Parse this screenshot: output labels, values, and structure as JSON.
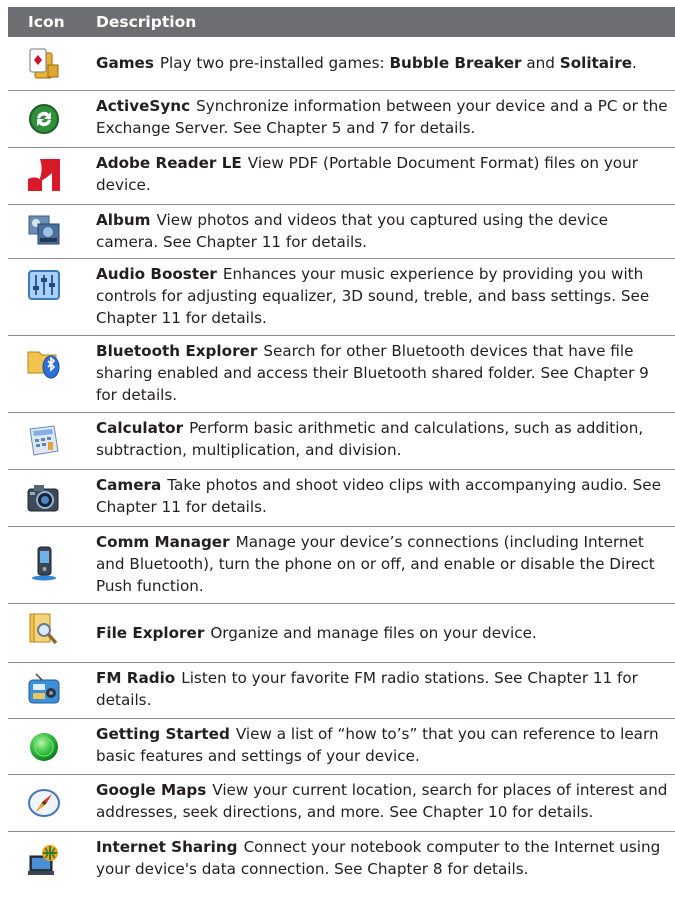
{
  "header": {
    "icon_label": "Icon",
    "description_label": "Description"
  },
  "rows": [
    {
      "icon": "games-icon",
      "name": "Games",
      "parts": [
        "Play two pre-installed games: ",
        "Bubble Breaker",
        " and ",
        "Solitaire",
        "."
      ]
    },
    {
      "icon": "activesync-icon",
      "name": "ActiveSync",
      "text": "Synchronize information between your device and a PC or the Exchange Server. See Chapter 5 and 7 for details."
    },
    {
      "icon": "adobe-reader-icon",
      "name": "Adobe Reader LE",
      "text": "View PDF (Portable Document Format) files on your device."
    },
    {
      "icon": "album-icon",
      "name": "Album",
      "text": "View photos and videos that you captured using the device camera. See Chapter 11 for details."
    },
    {
      "icon": "audio-booster-icon",
      "name": "Audio Booster",
      "text": "Enhances your music experience by providing you with controls for adjusting equalizer, 3D sound, treble, and bass settings. See Chapter 11 for details."
    },
    {
      "icon": "bluetooth-explorer-icon",
      "name": "Bluetooth Explorer",
      "text": "Search for other Bluetooth devices that have file sharing enabled and access their Bluetooth shared folder. See Chapter 9 for details."
    },
    {
      "icon": "calculator-icon",
      "name": "Calculator",
      "text": "Perform basic arithmetic and calculations, such as addition, subtraction, multiplication, and division."
    },
    {
      "icon": "camera-icon",
      "name": "Camera",
      "text": "Take photos and shoot video clips with accompanying audio. See Chapter 11 for details."
    },
    {
      "icon": "comm-manager-icon",
      "name": "Comm Manager",
      "text": "Manage your device’s connections (including Internet and Bluetooth), turn the phone on or off, and enable or disable the Direct Push function."
    },
    {
      "icon": "file-explorer-icon",
      "name": "File Explorer",
      "text": "Organize and manage files on your device."
    },
    {
      "icon": "fm-radio-icon",
      "name": "FM Radio",
      "text": "Listen to your favorite FM radio stations. See Chapter 11 for details."
    },
    {
      "icon": "getting-started-icon",
      "name": "Getting Started",
      "text": "View a list of “how to’s” that you can reference to learn basic features and settings of your device."
    },
    {
      "icon": "google-maps-icon",
      "name": "Google Maps",
      "text": "View your current location, search for places of interest and addresses, seek directions, and more. See Chapter 10 for details."
    },
    {
      "icon": "internet-sharing-icon",
      "name": "Internet Sharing",
      "text": "Connect your notebook computer to the Internet using your device's data connection. See Chapter 8 for details."
    }
  ]
}
